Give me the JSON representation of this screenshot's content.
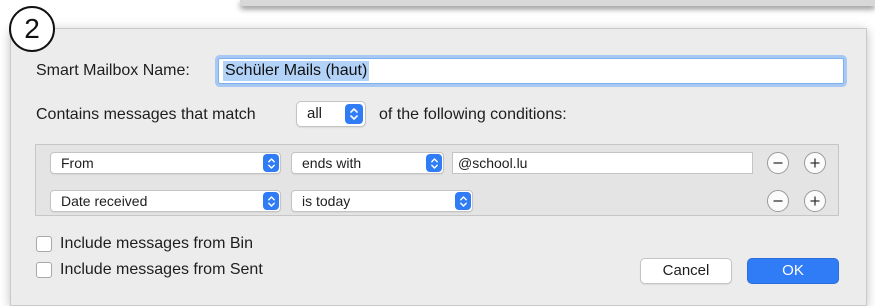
{
  "step_badge": "2",
  "name_label": "Smart Mailbox Name:",
  "name_value": "Schüler Mails (haut)",
  "match_prefix": "Contains messages that match",
  "match_value": "all",
  "match_suffix": "of the following conditions:",
  "conditions": [
    {
      "field": "From",
      "operator": "ends with",
      "value": "@school.lu"
    },
    {
      "field": "Date received",
      "operator": "is today"
    }
  ],
  "include_bin_label": "Include messages from Bin",
  "include_sent_label": "Include messages from Sent",
  "include_bin_checked": false,
  "include_sent_checked": false,
  "cancel_label": "Cancel",
  "ok_label": "OK",
  "colors": {
    "accent": "#2f7cf6",
    "sheet_bg": "#ececec"
  },
  "icons": {
    "stepper": "up-down-chevron-icon",
    "remove": "minus-icon",
    "add": "plus-icon"
  }
}
